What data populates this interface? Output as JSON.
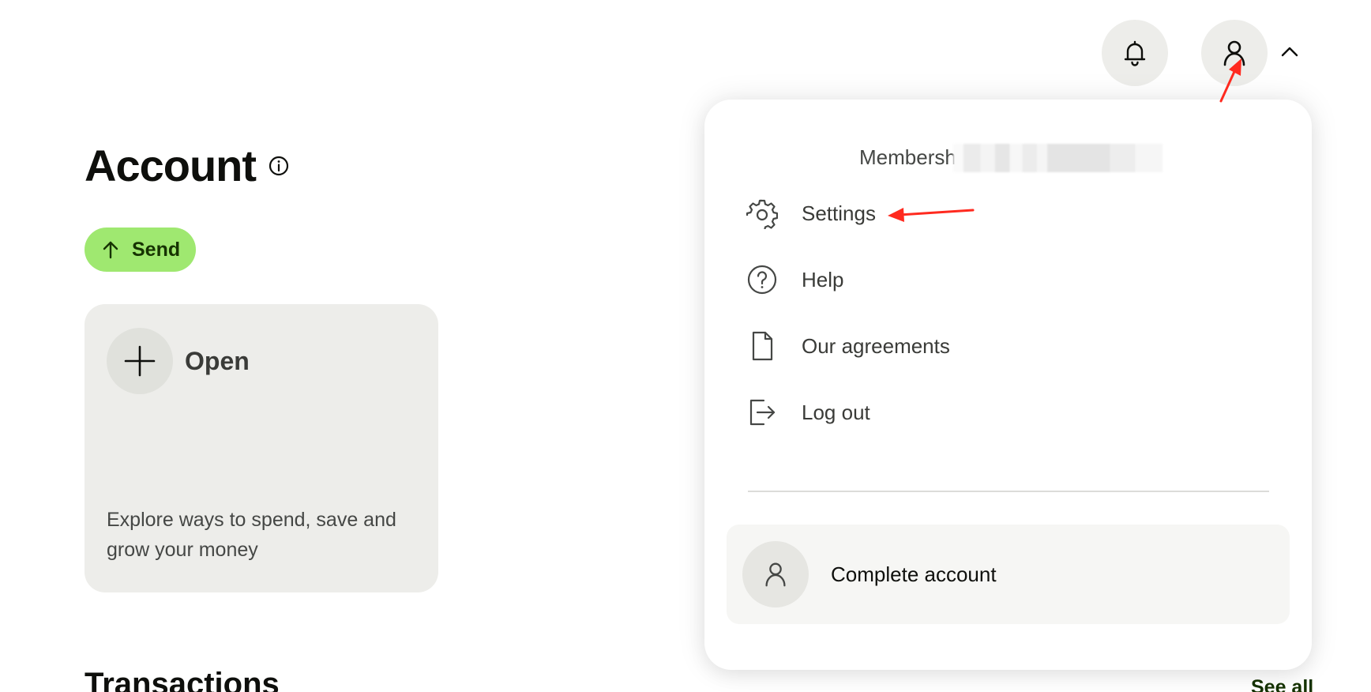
{
  "header": {
    "bell_icon": "bell-icon",
    "profile_icon": "user-icon",
    "chevron_icon": "chevron-up-icon"
  },
  "main": {
    "title": "Account",
    "info_icon": "info-icon",
    "send_label": "Send",
    "open_card": {
      "label": "Open",
      "description": "Explore ways to spend, save and grow your money"
    },
    "transactions_title": "Transactions",
    "see_all_label": "See all"
  },
  "dropdown": {
    "membership_label": "Membersh",
    "items": [
      {
        "label": "Settings",
        "icon": "gear-icon"
      },
      {
        "label": "Help",
        "icon": "help-circle-icon"
      },
      {
        "label": "Our agreements",
        "icon": "document-icon"
      },
      {
        "label": "Log out",
        "icon": "logout-icon"
      }
    ],
    "complete_account_label": "Complete account"
  },
  "colors": {
    "accent_green": "#9fe870",
    "dark_green": "#163300",
    "annotation_red": "#ff2a1f",
    "surface_grey": "#ededea"
  }
}
